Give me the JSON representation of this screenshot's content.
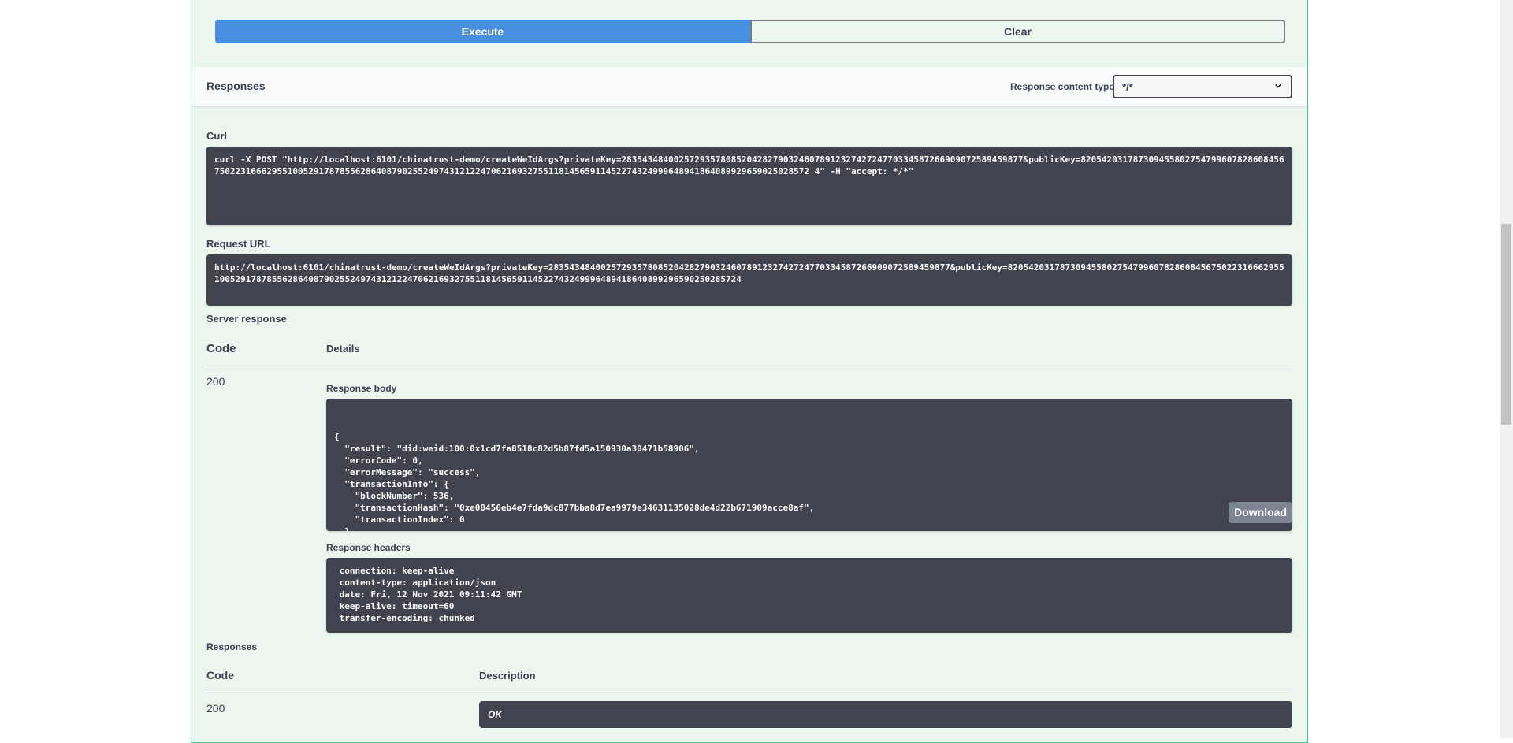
{
  "actions": {
    "execute_label": "Execute",
    "clear_label": "Clear"
  },
  "responses_header": {
    "title": "Responses",
    "content_type_label": "Response content type",
    "content_type_value": "*/*"
  },
  "curl": {
    "label": "Curl",
    "command": "curl -X POST \"http://localhost:6101/chinatrust-demo/createWeIdArgs?privateKey=28354348400257293578085204282790324607891232742724770334587266909072589459877&publicKey=820542031787309455802754799607828608456750223166629551005291787855628640879025524974312122470621693275511814565911452274324999648941864089929659025028572 4\" -H \"accept: */*\""
  },
  "request_url": {
    "label": "Request URL",
    "value": "http://localhost:6101/chinatrust-demo/createWeIdArgs?privateKey=28354348400257293578085204282790324607891232742724770334587266909072589459877&publicKey=8205420317873094558027547996078286084567502231666295510052917878556286408790255249743121224706216932755118145659114522743249996489418640899296590250285724"
  },
  "server_response": {
    "title": "Server response",
    "code_header": "Code",
    "details_header": "Details",
    "code": "200",
    "body_label": "Response body",
    "body": "{\n  \"result\": \"did:weid:100:0x1cd7fa8518c82d5b87fd5a150930a30471b58906\",\n  \"errorCode\": 0,\n  \"errorMessage\": \"success\",\n  \"transactionInfo\": {\n    \"blockNumber\": 536,\n    \"transactionHash\": \"0xe08456eb4e7fda9dc877bba8d7ea9979e34631135028de4d22b671909acce8af\",\n    \"transactionIndex\": 0\n  }\n}",
    "download_label": "Download",
    "headers_label": "Response headers",
    "headers": " connection: keep-alive\n content-type: application/json\n date: Fri, 12 Nov 2021 09:11:42 GMT\n keep-alive: timeout=60\n transfer-encoding: chunked"
  },
  "responses": {
    "title": "Responses",
    "code_header": "Code",
    "description_header": "Description",
    "rows": [
      {
        "code": "200",
        "description": "OK"
      }
    ]
  }
}
